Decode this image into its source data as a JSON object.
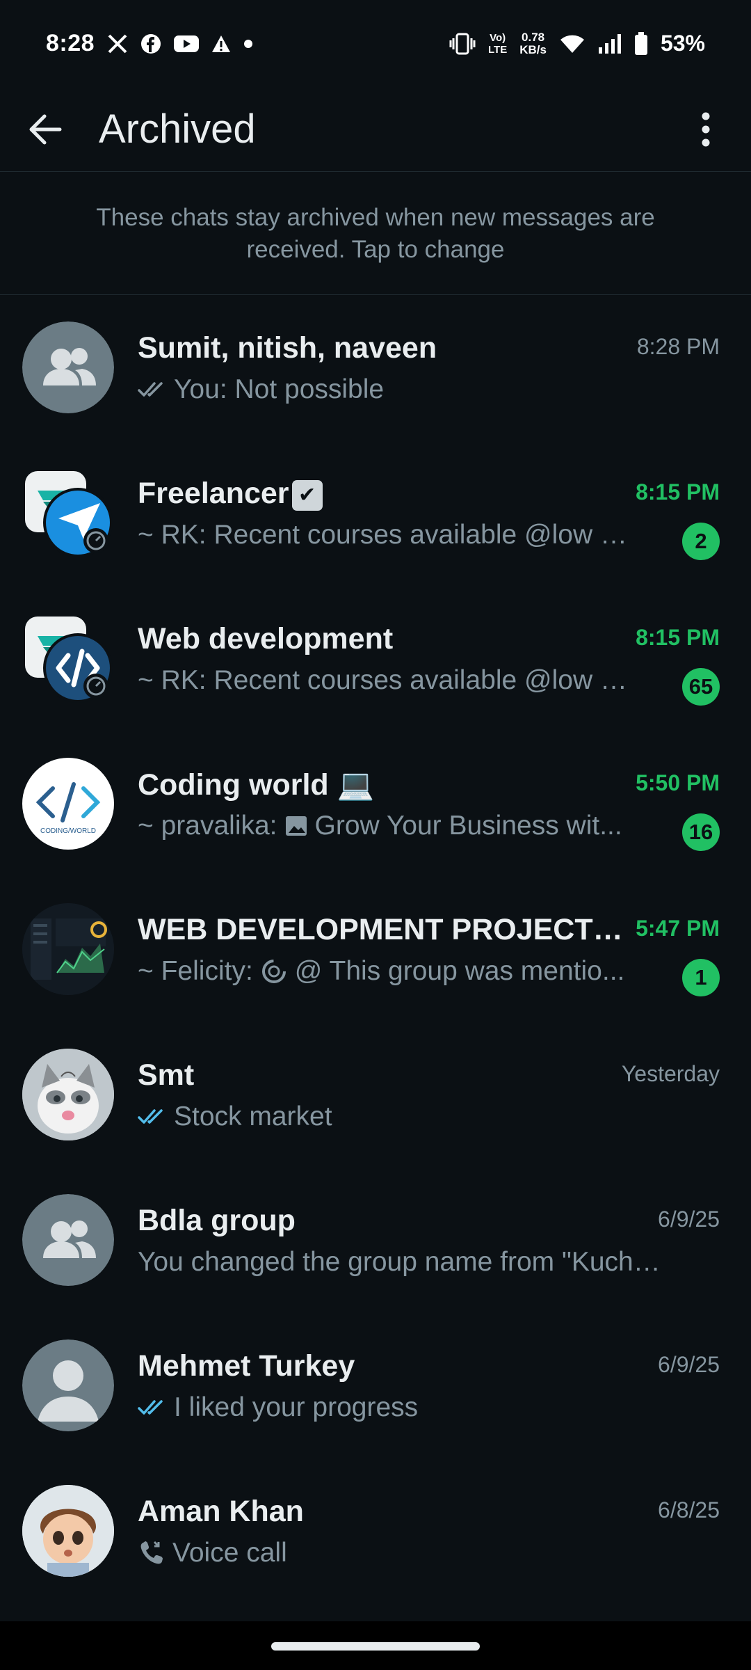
{
  "status_bar": {
    "time": "8:28",
    "net_top": "Vo)",
    "net_bottom": "LTE",
    "speed_top": "0.78",
    "speed_bottom": "KB/s",
    "battery": "53%",
    "icons": [
      "x-icon",
      "facebook-icon",
      "youtube-icon",
      "alert-icon",
      "dot-icon",
      "vibrate-icon",
      "wifi-icon",
      "signal-icon",
      "battery-icon"
    ]
  },
  "appbar": {
    "title": "Archived"
  },
  "banner": {
    "text": "These chats stay archived when new messages are received. Tap to change"
  },
  "colors": {
    "background": "#0b1014",
    "accent_green": "#21c063",
    "muted": "#8696a0",
    "read_tick_blue": "#53bdeb"
  },
  "chats": [
    {
      "name": "Sumit, nitish, naveen",
      "time": "8:28 PM",
      "preview": "You: Not possible",
      "tick": "double-grey",
      "avatar": "group-icon"
    },
    {
      "name": "Freelancer",
      "name_emoji": "✔",
      "time": "8:15 PM",
      "preview": "~ RK: Recent courses available  @low pr...",
      "badge": "2",
      "avatar": "community-icon"
    },
    {
      "name": "Web development",
      "time": "8:15 PM",
      "preview": "~ RK: Recent courses available  @low pr...",
      "badge": "65",
      "avatar": "community-code-icon"
    },
    {
      "name": "Coding world",
      "name_emoji": "💻",
      "time": "5:50 PM",
      "preview_sender": "~ pravalika:",
      "preview": "Grow Your Business wit...",
      "badge": "16",
      "avatar": "code-logo",
      "avatar_caption": "CODING/WORLD"
    },
    {
      "name": "WEB DEVELOPMENT PROJECTS(...",
      "time": "5:47 PM",
      "preview_sender": "~ Felicity:",
      "preview": "@ This group was mentio...",
      "badge": "1",
      "avatar": "dashboard-image"
    },
    {
      "name": "Smt",
      "time": "Yesterday",
      "preview": "Stock market",
      "tick": "double-blue",
      "avatar": "cat-photo"
    },
    {
      "name": "Bdla group",
      "time": "6/9/25",
      "preview": "You changed the group name from \"Kuch B...",
      "avatar": "group-icon"
    },
    {
      "name": "Mehmet Turkey",
      "time": "6/9/25",
      "preview": "I liked your progress",
      "tick": "double-blue",
      "avatar": "person-icon"
    },
    {
      "name": "Aman Khan",
      "time": "6/8/25",
      "preview": "Voice call",
      "avatar": "cartoon-photo"
    }
  ]
}
